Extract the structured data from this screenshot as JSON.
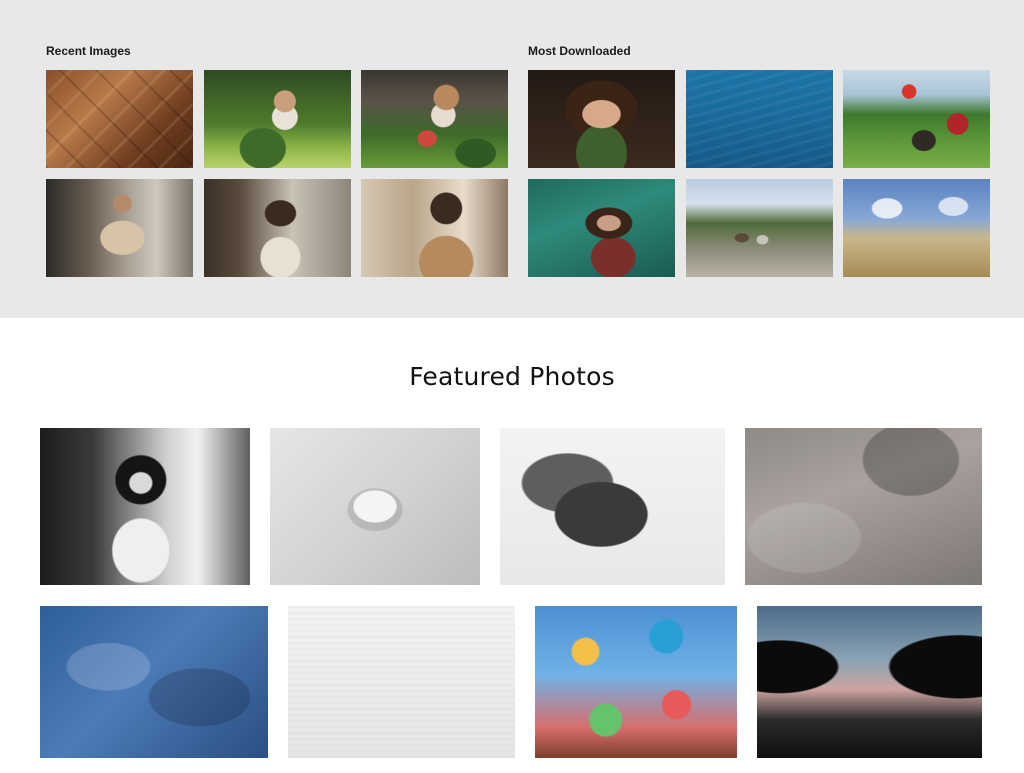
{
  "sections": {
    "recent_title": "Recent Images",
    "most_downloaded_title": "Most Downloaded",
    "featured_title": "Featured Photos"
  },
  "recent_images": [
    {
      "name": "thumb-wood-floor"
    },
    {
      "name": "thumb-girl-watermelon-1"
    },
    {
      "name": "thumb-girl-watermelon-2"
    },
    {
      "name": "thumb-woman-street-1"
    },
    {
      "name": "thumb-woman-street-2"
    },
    {
      "name": "thumb-woman-street-3"
    }
  ],
  "most_downloaded": [
    {
      "name": "thumb-woman-face-leaf"
    },
    {
      "name": "thumb-ocean-water"
    },
    {
      "name": "thumb-girl-bicycle"
    },
    {
      "name": "thumb-woman-in-water"
    },
    {
      "name": "thumb-couple-cliff"
    },
    {
      "name": "thumb-desert-sky"
    }
  ],
  "featured_photos": [
    {
      "name": "photo-bw-woman-street"
    },
    {
      "name": "photo-plaster-face"
    },
    {
      "name": "photo-grunge-frame"
    },
    {
      "name": "photo-stone-wall"
    },
    {
      "name": "photo-blue-texture"
    },
    {
      "name": "photo-white-paper"
    },
    {
      "name": "photo-colorful-collage"
    },
    {
      "name": "photo-sunset-trees"
    }
  ]
}
